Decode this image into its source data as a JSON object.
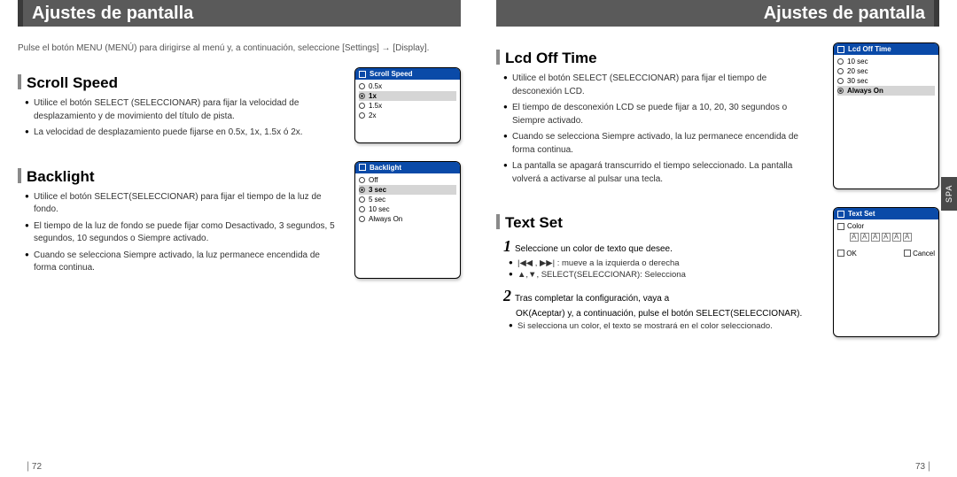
{
  "header": {
    "left_title": "Ajustes de pantalla",
    "right_title": "Ajustes de pantalla"
  },
  "intro": "Pulse el botón MENU (MENÚ) para dirigirse al menú y, a continuación, seleccione [Settings] → [Display].",
  "scroll_speed": {
    "title": "Scroll Speed",
    "bullets": [
      "Utilice el botón SELECT (SELECCIONAR) para fijar la velocidad de desplazamiento y de movimiento del título de pista.",
      "La velocidad de desplazamiento puede fijarse en 0.5x, 1x, 1.5x ó 2x."
    ],
    "screen": {
      "head": "Scroll Speed",
      "options": [
        "0.5x",
        "1x",
        "1.5x",
        "2x"
      ],
      "selected": "1x"
    }
  },
  "backlight": {
    "title": "Backlight",
    "bullets": [
      "Utilice el botón SELECT(SELECCIONAR) para fijar el tiempo de la luz de fondo.",
      "El tiempo de la luz de fondo se puede fijar como Desactivado, 3 segundos, 5 segundos, 10 segundos o Siempre activado.",
      "Cuando se selecciona Siempre activado, la luz permanece encendida de forma continua."
    ],
    "screen": {
      "head": "Backlight",
      "options": [
        "Off",
        "3 sec",
        "5 sec",
        "10 sec",
        "Always On"
      ],
      "selected": "3 sec"
    }
  },
  "lcd_off": {
    "title": "Lcd Off Time",
    "bullets": [
      "Utilice el botón SELECT (SELECCIONAR) para fijar el tiempo de desconexión LCD.",
      "El tiempo de desconexión LCD se puede fijar a 10, 20, 30 segundos o Siempre activado.",
      "Cuando se selecciona Siempre activado, la luz permanece encendida de forma continua.",
      "La pantalla se apagará transcurrido el tiempo seleccionado. La pantalla volverá a activarse al pulsar una tecla."
    ],
    "screen": {
      "head": "Lcd Off Time",
      "options": [
        "10 sec",
        "20 sec",
        "30 sec",
        "Always On"
      ],
      "selected": "Always On"
    }
  },
  "text_set": {
    "title": "Text Set",
    "step1": "Seleccione un color de texto que desee.",
    "step1_subs": [
      "|◀◀ , ▶▶| : mueve a la izquierda o derecha",
      "▲,▼, SELECT(SELECCIONAR): Selecciona"
    ],
    "step2a": "Tras completar la configuración, vaya a",
    "step2b": "OK(Aceptar) y, a continuación, pulse el botón SELECT(SELECCIONAR).",
    "step2_subs": [
      "Si selecciona un color, el texto se mostrará en el color seleccionado."
    ],
    "screen": {
      "head": "Text Set",
      "label": "Color",
      "ok": "OK",
      "cancel": "Cancel"
    }
  },
  "side_tab": "SPA",
  "pages": {
    "left": "72",
    "right": "73"
  }
}
